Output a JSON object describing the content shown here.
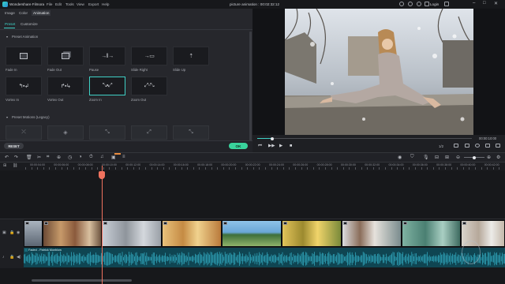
{
  "app": {
    "name": "Wondershare Filmora",
    "project_title": "picture animation : 00:02:32:12",
    "login_label": "Login",
    "menu": [
      "File",
      "Edit",
      "Tools",
      "View",
      "Export",
      "Help"
    ]
  },
  "left_panel": {
    "top_tabs": [
      "Image",
      "Color",
      "Animation"
    ],
    "active_top_tab": "Animation",
    "sub_tabs": [
      "Preset",
      "Customize"
    ],
    "active_sub_tab": "Preset",
    "section_preset": "Preset Animation",
    "section_legacy": "Preset Motions (Legacy)",
    "presets_row1": [
      {
        "label": "Fade In",
        "icon": "fade-in-icon"
      },
      {
        "label": "Fade Out",
        "icon": "fade-out-icon"
      },
      {
        "label": "Pause",
        "icon": "pause-icon"
      },
      {
        "label": "Slide Right",
        "icon": "slide-right-icon"
      },
      {
        "label": "Slide Up",
        "icon": "slide-up-icon"
      }
    ],
    "presets_row2": [
      {
        "label": "Vortex In",
        "icon": "vortex-in-icon"
      },
      {
        "label": "Vortex Out",
        "icon": "vortex-out-icon"
      },
      {
        "label": "Zoom In",
        "icon": "zoom-in-icon"
      },
      {
        "label": "Zoom Out",
        "icon": "zoom-out-icon"
      }
    ],
    "selected_preset": "Zoom In",
    "reset_label": "RESET",
    "ok_label": "OK"
  },
  "preview": {
    "timecode": "00:00:10:00",
    "ratio": "1/2",
    "progress_fraction": 0.07
  },
  "timeline": {
    "ruler_labels": [
      "00:00:04:00",
      "00:00:06:00",
      "00:00:08:00",
      "00:00:10:00",
      "00:00:12:00",
      "00:00:14:00",
      "00:00:16:00",
      "00:00:18:00",
      "00:00:20:00",
      "00:00:22:00",
      "00:00:24:00",
      "00:00:26:00",
      "00:00:28:00",
      "00:00:30:00",
      "00:00:32:00",
      "00:00:34:00",
      "00:00:36:00",
      "00:00:38:00",
      "00:00:40:00",
      "00:00:42:00"
    ],
    "audio_clip_label": "Faded - Patrick Monblow"
  },
  "colors": {
    "accent": "#3fd0c5",
    "ok_button": "#39d39c",
    "playhead": "#f0725e",
    "audio_clip": "#0f4552"
  }
}
